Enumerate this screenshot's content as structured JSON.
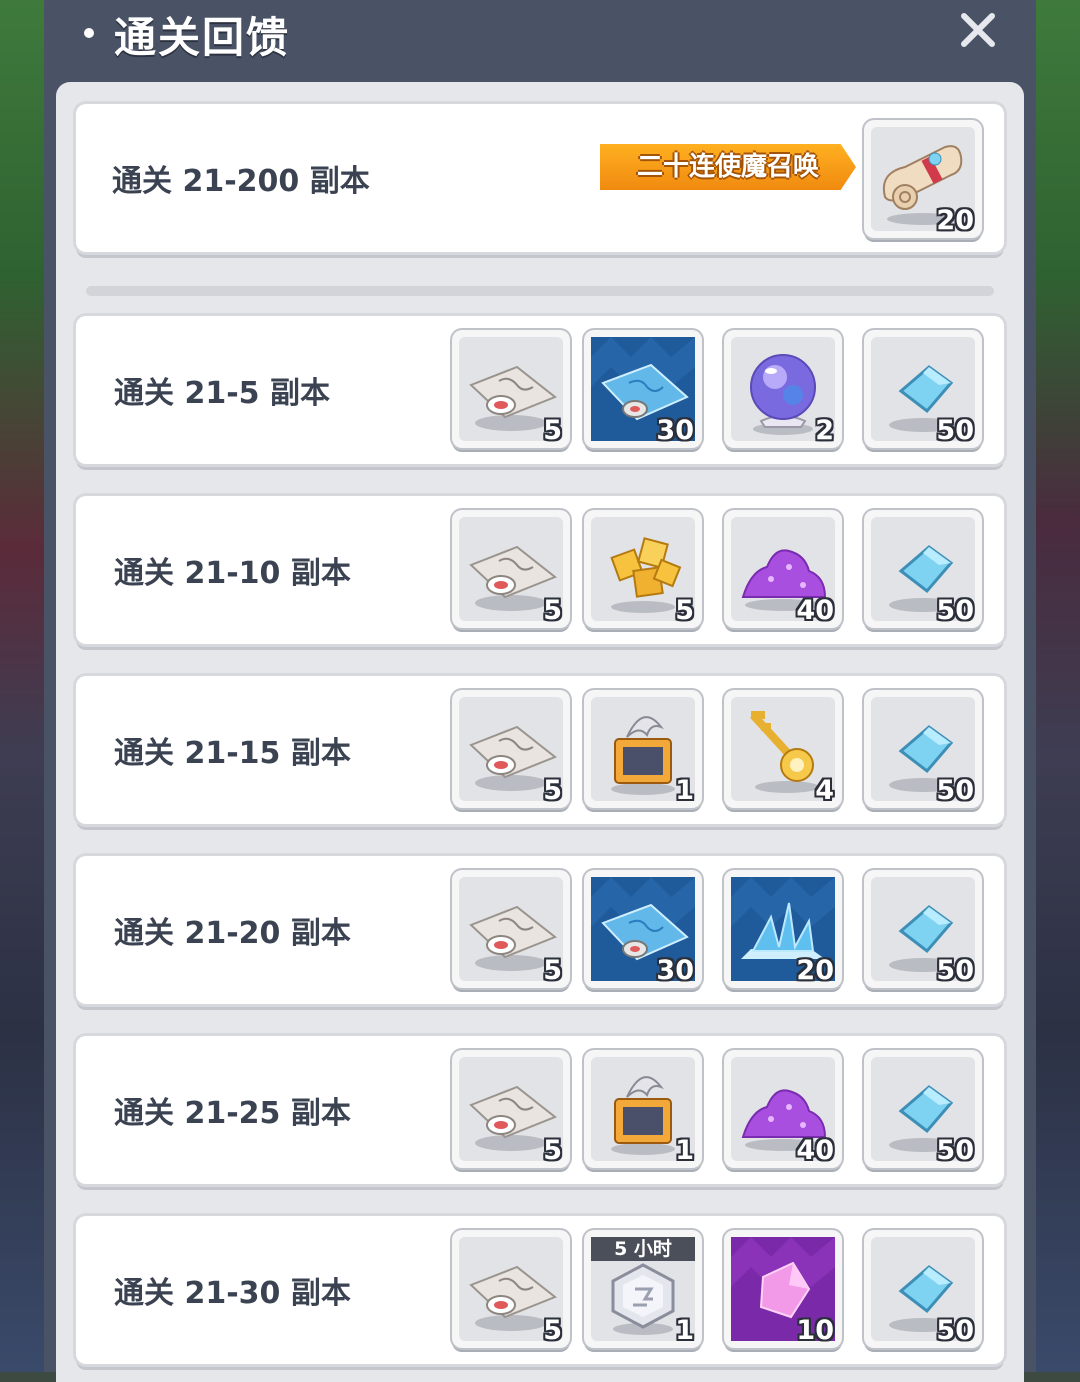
{
  "header": {
    "title": "通关回馈"
  },
  "top_reward": {
    "label": "通关 21-200 副本",
    "tag": "二十连使魔召唤",
    "item": {
      "icon": "scroll-icon",
      "count": "20"
    }
  },
  "rows": [
    {
      "label": "通关 21-5 副本",
      "items": [
        {
          "icon": "map-compass-icon",
          "count": "5"
        },
        {
          "icon": "blue-map-icon",
          "count": "30"
        },
        {
          "icon": "crystal-ball-icon",
          "count": "2"
        },
        {
          "icon": "blue-gem-icon",
          "count": "50"
        }
      ]
    },
    {
      "label": "通关 21-10 副本",
      "items": [
        {
          "icon": "map-compass-icon",
          "count": "5"
        },
        {
          "icon": "gold-cubes-icon",
          "count": "5"
        },
        {
          "icon": "purple-dust-icon",
          "count": "40"
        },
        {
          "icon": "blue-gem-icon",
          "count": "50"
        }
      ]
    },
    {
      "label": "通关 21-15 副本",
      "items": [
        {
          "icon": "map-compass-icon",
          "count": "5"
        },
        {
          "icon": "treasure-chest-icon",
          "count": "1"
        },
        {
          "icon": "golden-key-icon",
          "count": "4"
        },
        {
          "icon": "blue-gem-icon",
          "count": "50"
        }
      ]
    },
    {
      "label": "通关 21-20 副本",
      "items": [
        {
          "icon": "map-compass-icon",
          "count": "5"
        },
        {
          "icon": "blue-map-icon",
          "count": "30"
        },
        {
          "icon": "ice-shard-icon",
          "count": "20"
        },
        {
          "icon": "blue-gem-icon",
          "count": "50"
        }
      ]
    },
    {
      "label": "通关 21-25 副本",
      "items": [
        {
          "icon": "map-compass-icon",
          "count": "5"
        },
        {
          "icon": "treasure-chest-icon",
          "count": "1"
        },
        {
          "icon": "purple-dust-icon",
          "count": "40"
        },
        {
          "icon": "blue-gem-icon",
          "count": "50"
        }
      ]
    },
    {
      "label": "通关 21-30 副本",
      "items": [
        {
          "icon": "map-compass-icon",
          "count": "5"
        },
        {
          "icon": "hex-crystal-icon",
          "count": "1",
          "badge": "5 小时"
        },
        {
          "icon": "purple-crystal-icon",
          "count": "10"
        },
        {
          "icon": "blue-gem-icon",
          "count": "50"
        }
      ]
    }
  ],
  "colors": {
    "panel": "#4a5366",
    "list_bg": "#e6e7ea",
    "tag_orange": "#f5a01a",
    "label_text": "#3b4352"
  }
}
